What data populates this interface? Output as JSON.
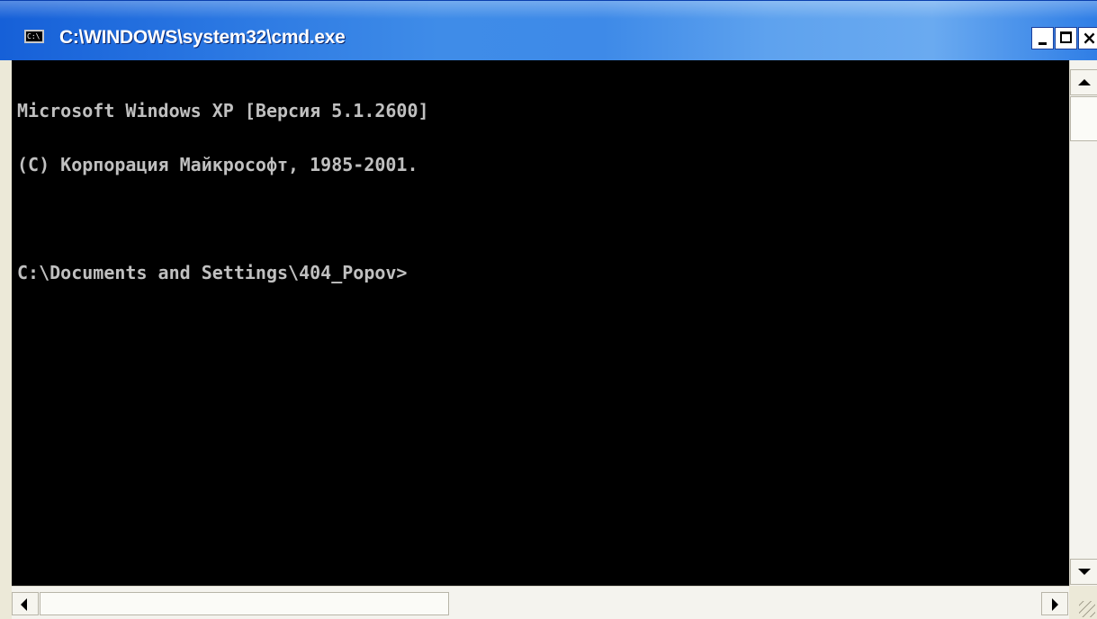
{
  "window": {
    "title": "C:\\WINDOWS\\system32\\cmd.exe",
    "icon": "cmd-icon",
    "icon_text": "C:\\",
    "controls": {
      "minimize": "minimize",
      "maximize": "maximize",
      "close": "×"
    }
  },
  "console": {
    "lines": [
      "Microsoft Windows XP [Версия 5.1.2600]",
      "(С) Корпорация Майкрософт, 1985-2001.",
      "",
      "C:\\Documents and Settings\\404_Popov>"
    ]
  },
  "colors": {
    "titlebar": "#2a77e2",
    "console_bg": "#000000",
    "console_fg": "#c0c0c0"
  }
}
